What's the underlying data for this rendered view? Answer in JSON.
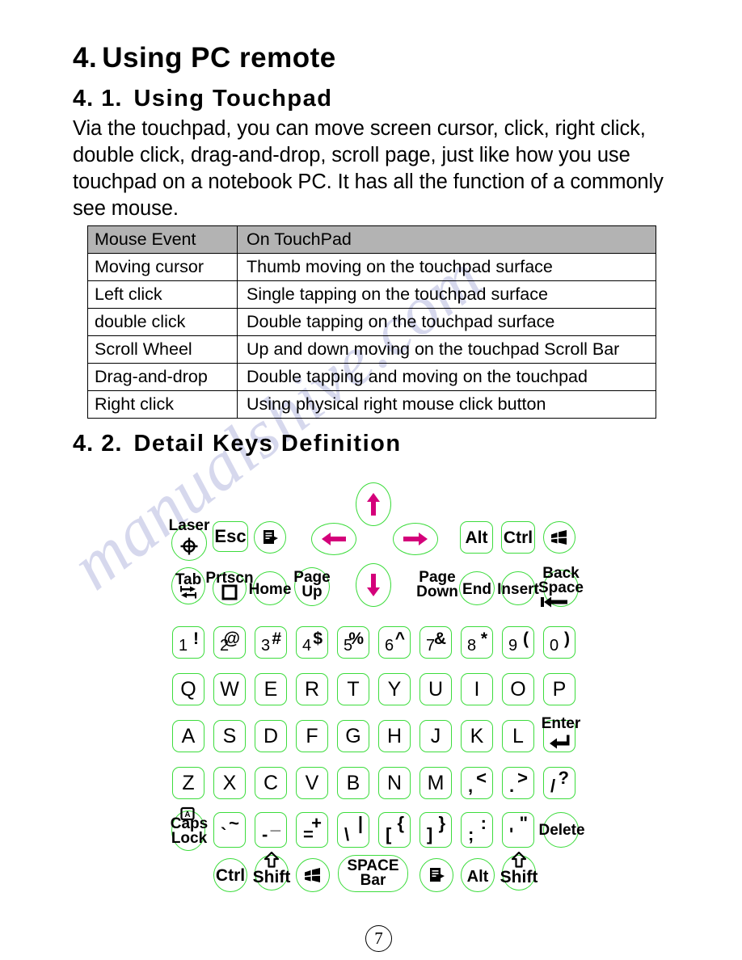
{
  "document": {
    "page_number": "7",
    "watermark": "manualshive.com"
  },
  "headings": {
    "h1_number": "4.",
    "h1_title": "Using PC remote",
    "h2_1_number": "4. 1.",
    "h2_1_title": "Using Touchpad",
    "h2_2_number": "4. 2.",
    "h2_2_title": "Detail Keys Definition"
  },
  "paragraph": "Via the touchpad, you can move screen cursor, click, right click, double click, drag-and-drop, scroll page, just like how you use touchpad on a notebook PC.  It has all the function of a  commonly see mouse.",
  "table": {
    "headers": [
      "Mouse Event",
      "On   TouchPad"
    ],
    "rows": [
      [
        "Moving cursor",
        "Thumb moving on the touchpad surface"
      ],
      [
        "Left click",
        " Single tapping on the touchpad surface"
      ],
      [
        "double click",
        " Double tapping on the touchpad surface"
      ],
      [
        "Scroll Wheel",
        "Up and down moving on the touchpad Scroll Bar"
      ],
      [
        "Drag-and-drop",
        "Double tapping and moving on the touchpad"
      ],
      [
        "Right click",
        "Using physical right mouse click button"
      ]
    ]
  },
  "keyboard": {
    "outline_color": "#3ddc3d",
    "arrow_color": "#d4007a",
    "row_fn1": [
      {
        "label": "Laser",
        "icon": "laser-crosshair-icon"
      },
      {
        "label": "Esc"
      },
      {
        "label": "",
        "icon": "menu-document-icon"
      },
      {
        "label": "",
        "icon": "arrow-left-icon"
      },
      {
        "label": "",
        "icon": "arrow-right-icon"
      },
      {
        "label": "Alt"
      },
      {
        "label": "Ctrl"
      },
      {
        "label": "",
        "icon": "windows-logo-icon"
      }
    ],
    "arrow_up": {
      "icon": "arrow-up-icon"
    },
    "arrow_down": {
      "icon": "arrow-down-icon"
    },
    "row_fn2": [
      {
        "label": "Tab",
        "icon": "tab-arrows-icon"
      },
      {
        "label": "Prtscn",
        "icon": "square-icon"
      },
      {
        "label": "Home"
      },
      {
        "label": "Page Up",
        "line1": "Page",
        "line2": "Up"
      },
      {
        "label": "Page Down",
        "line1": "Page",
        "line2": "Down"
      },
      {
        "label": "End"
      },
      {
        "label": "Insert"
      },
      {
        "label": "Back Space",
        "line1": "Back",
        "line2": "Space",
        "icon": "backspace-arrow-icon"
      }
    ],
    "row_numbers": [
      {
        "base": "1",
        "shift": "!"
      },
      {
        "base": "2",
        "shift": "@"
      },
      {
        "base": "3",
        "shift": "#"
      },
      {
        "base": "4",
        "shift": "$"
      },
      {
        "base": "5",
        "shift": "%"
      },
      {
        "base": "6",
        "shift": "^"
      },
      {
        "base": "7",
        "shift": "&"
      },
      {
        "base": "8",
        "shift": "*"
      },
      {
        "base": "9",
        "shift": "("
      },
      {
        "base": "0",
        "shift": ")"
      }
    ],
    "row_q": [
      "Q",
      "W",
      "E",
      "R",
      "T",
      "Y",
      "U",
      "I",
      "O",
      "P"
    ],
    "row_a": [
      "A",
      "S",
      "D",
      "F",
      "G",
      "H",
      "J",
      "K",
      "L"
    ],
    "enter": {
      "label": "Enter",
      "icon": "enter-arrow-icon"
    },
    "row_z": [
      "Z",
      "X",
      "C",
      "V",
      "B",
      "N",
      "M"
    ],
    "row_z_symbols": [
      {
        "base": ",",
        "shift": "<"
      },
      {
        "base": ".",
        "shift": ">"
      },
      {
        "base": "/",
        "shift": "?"
      }
    ],
    "caps_lock": {
      "line1": "Caps",
      "line2": "Lock",
      "icon": "caps-lock-icon"
    },
    "row_symbols": [
      {
        "base": "`",
        "shift": "~"
      },
      {
        "base": "-",
        "shift": "_"
      },
      {
        "base": "=",
        "shift": "+"
      },
      {
        "base": "\\",
        "shift": "|"
      },
      {
        "base": "[",
        "shift": "{"
      },
      {
        "base": "]",
        "shift": "}"
      },
      {
        "base": ";",
        "shift": ":"
      },
      {
        "base": "'",
        "shift": "\""
      }
    ],
    "delete": {
      "label": "Delete"
    },
    "row_bottom": [
      {
        "label": "Ctrl"
      },
      {
        "label": "Shift",
        "icon": "shift-arrow-icon"
      },
      {
        "label": "",
        "icon": "windows-logo-icon"
      },
      {
        "label": "SPACE Bar",
        "line1": "SPACE",
        "line2": "Bar"
      },
      {
        "label": "",
        "icon": "menu-document-icon"
      },
      {
        "label": "Alt"
      },
      {
        "label": "Shift",
        "icon": "shift-arrow-icon"
      }
    ]
  }
}
